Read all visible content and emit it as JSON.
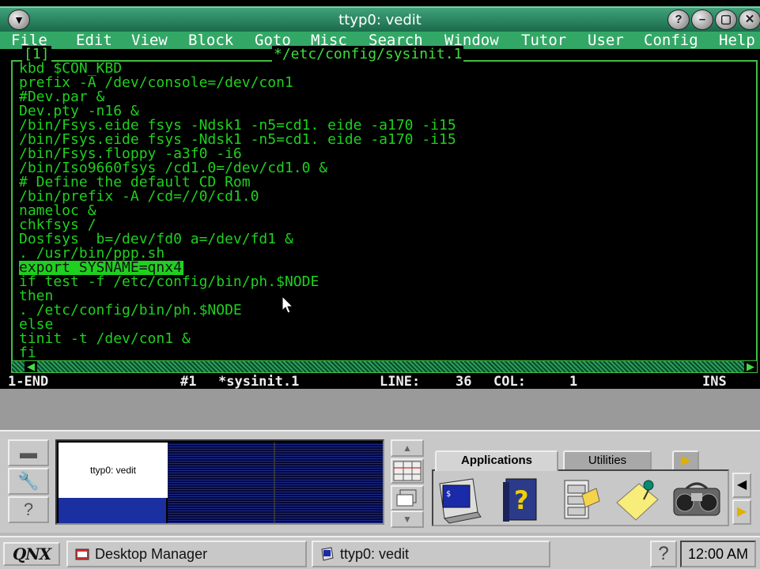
{
  "window": {
    "title": "ttyp0: vedit",
    "buttons": [
      "?",
      "–",
      "▢",
      "✕"
    ]
  },
  "menubar": {
    "items": [
      "File",
      "Edit",
      "View",
      "Block",
      "Goto",
      "Misc",
      "Search",
      "Window",
      "Tutor",
      "User",
      "Config",
      "Help"
    ]
  },
  "frame": {
    "number_label": "[1]",
    "file_label": "*/etc/config/sysinit.1"
  },
  "editor": {
    "lines": [
      "kbd $CON_KBD",
      "prefix -A /dev/console=/dev/con1",
      "#Dev.par &",
      "Dev.pty -n16 &",
      "/bin/Fsys.eide fsys -Ndsk1 -n5=cd1. eide -a170 -i15",
      "/bin/Fsys.eide fsys -Ndsk1 -n5=cd1. eide -a170 -i15",
      "/bin/Fsys.floppy -a3f0 -i6",
      "/bin/Iso9660fsys /cd1.0=/dev/cd1.0 &",
      "# Define the default CD Rom",
      "/bin/prefix -A /cd=//0/cd1.0",
      "nameloc &",
      "chkfsys /",
      "Dosfsys  b=/dev/fd0 a=/dev/fd1 &",
      ". /usr/bin/ppp.sh",
      "export SYSNAME=qnx4",
      "if test -f /etc/config/bin/ph.$NODE",
      "then",
      ". /etc/config/bin/ph.$NODE",
      "else",
      "tinit -t /dev/con1 &",
      "fi"
    ],
    "highlighted_line_index": 14
  },
  "statusbar": {
    "mode": "1-END",
    "buffer": "#1",
    "filename": "*sysinit.1",
    "line_label": "LINE:",
    "line_value": "36",
    "col_label": "COL:",
    "col_value": "1",
    "insert_mode": "INS"
  },
  "pager": {
    "window_label": "ttyp0: vedit"
  },
  "launcher": {
    "tabs": [
      "Applications",
      "Utilities"
    ],
    "active_tab": "Applications",
    "icons": [
      "terminal-icon",
      "help-book-icon",
      "file-manager-icon",
      "notepad-icon",
      "media-player-icon"
    ]
  },
  "taskbar": {
    "logo": "QNX",
    "tasks": [
      "Desktop Manager",
      "ttyp0: vedit"
    ],
    "help": "?",
    "clock": "12:00 AM"
  },
  "colors": {
    "editor_text": "#1fd01f",
    "titlebar": "#2a8a60",
    "menubar": "#33a866"
  }
}
